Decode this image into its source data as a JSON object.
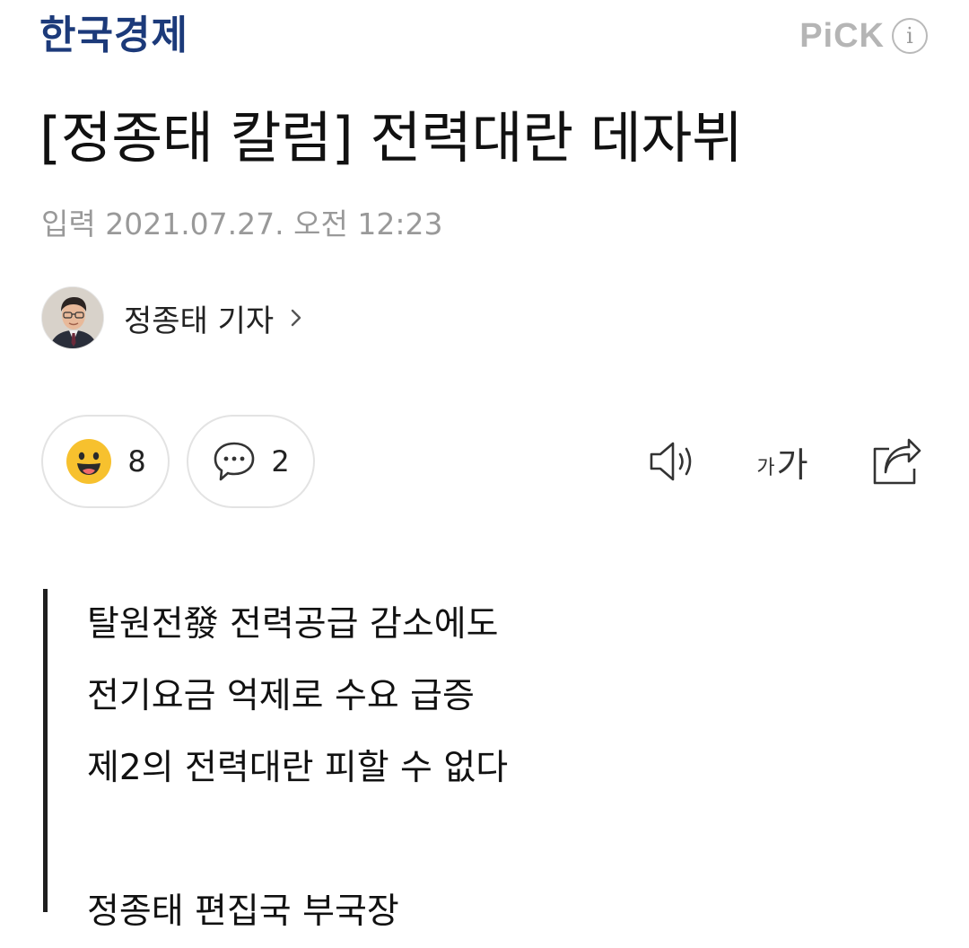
{
  "header": {
    "logo_text": "한국경제",
    "pick_label": "PiCK",
    "info_glyph": "i"
  },
  "article": {
    "title": "[정종태 칼럼] 전력대란 데자뷔",
    "dateline": "입력 2021.07.27. 오전 12:23",
    "author_name": "정종태 기자"
  },
  "actions": {
    "reaction_count": "8",
    "comment_count": "2",
    "font_size_small": "가",
    "font_size_large": "가"
  },
  "summary": {
    "lines": [
      "탈원전發 전력공급 감소에도",
      "전기요금 억제로 수요 급증",
      "제2의 전력대란 피할 수 없다"
    ],
    "byline": "정종태 편집국 부국장"
  },
  "colors": {
    "logo": "#1c3a7a",
    "pick": "#b5b5b5",
    "meta": "#999999",
    "emoji_yellow": "#f7c12e",
    "quote_bar": "#1f1f1f"
  },
  "icons": {
    "info": "info-icon",
    "chevron": "chevron-right-icon",
    "reaction": "smile-emoji-icon",
    "comment": "speech-bubble-icon",
    "tts": "speaker-icon",
    "share": "share-icon"
  }
}
